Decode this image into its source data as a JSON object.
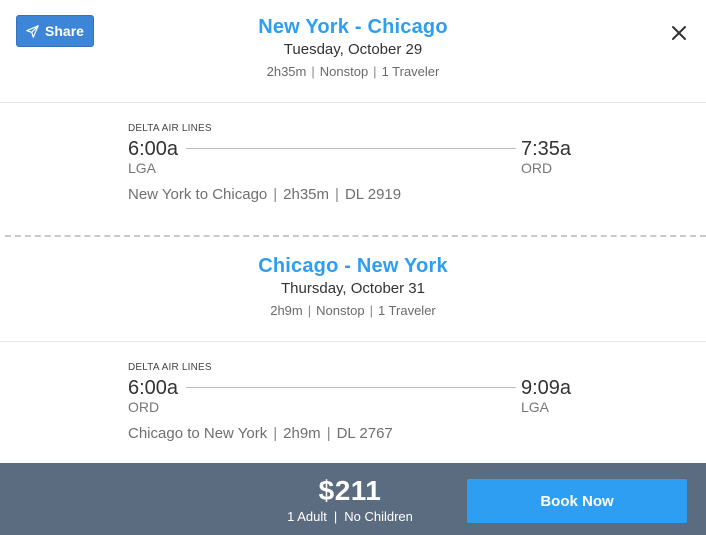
{
  "header": {
    "share_label": "Share"
  },
  "outbound": {
    "title": "New York - Chicago",
    "date": "Tuesday, October 29",
    "duration": "2h35m",
    "stops": "Nonstop",
    "travelers": "1 Traveler",
    "segment": {
      "airline": "DELTA AIR LINES",
      "depart_time": "6:00a",
      "arrive_time": "7:35a",
      "depart_code": "LGA",
      "arrive_code": "ORD",
      "route": "New York to Chicago",
      "duration": "2h35m",
      "flight": "DL 2919"
    }
  },
  "return": {
    "title": "Chicago - New York",
    "date": "Thursday, October 31",
    "duration": "2h9m",
    "stops": "Nonstop",
    "travelers": "1 Traveler",
    "segment": {
      "airline": "DELTA AIR LINES",
      "depart_time": "6:00a",
      "arrive_time": "9:09a",
      "depart_code": "ORD",
      "arrive_code": "LGA",
      "route": "Chicago to New York",
      "duration": "2h9m",
      "flight": "DL 2767"
    }
  },
  "footer": {
    "price": "$211",
    "adults": "1 Adult",
    "children": "No Children",
    "book_label": "Book Now"
  },
  "colors": {
    "accent": "#2e9ef2",
    "share_button": "#3d85d6",
    "footer_bg": "#5c6c80"
  },
  "icons": {
    "share": "paper-plane-icon",
    "close": "close-icon"
  }
}
